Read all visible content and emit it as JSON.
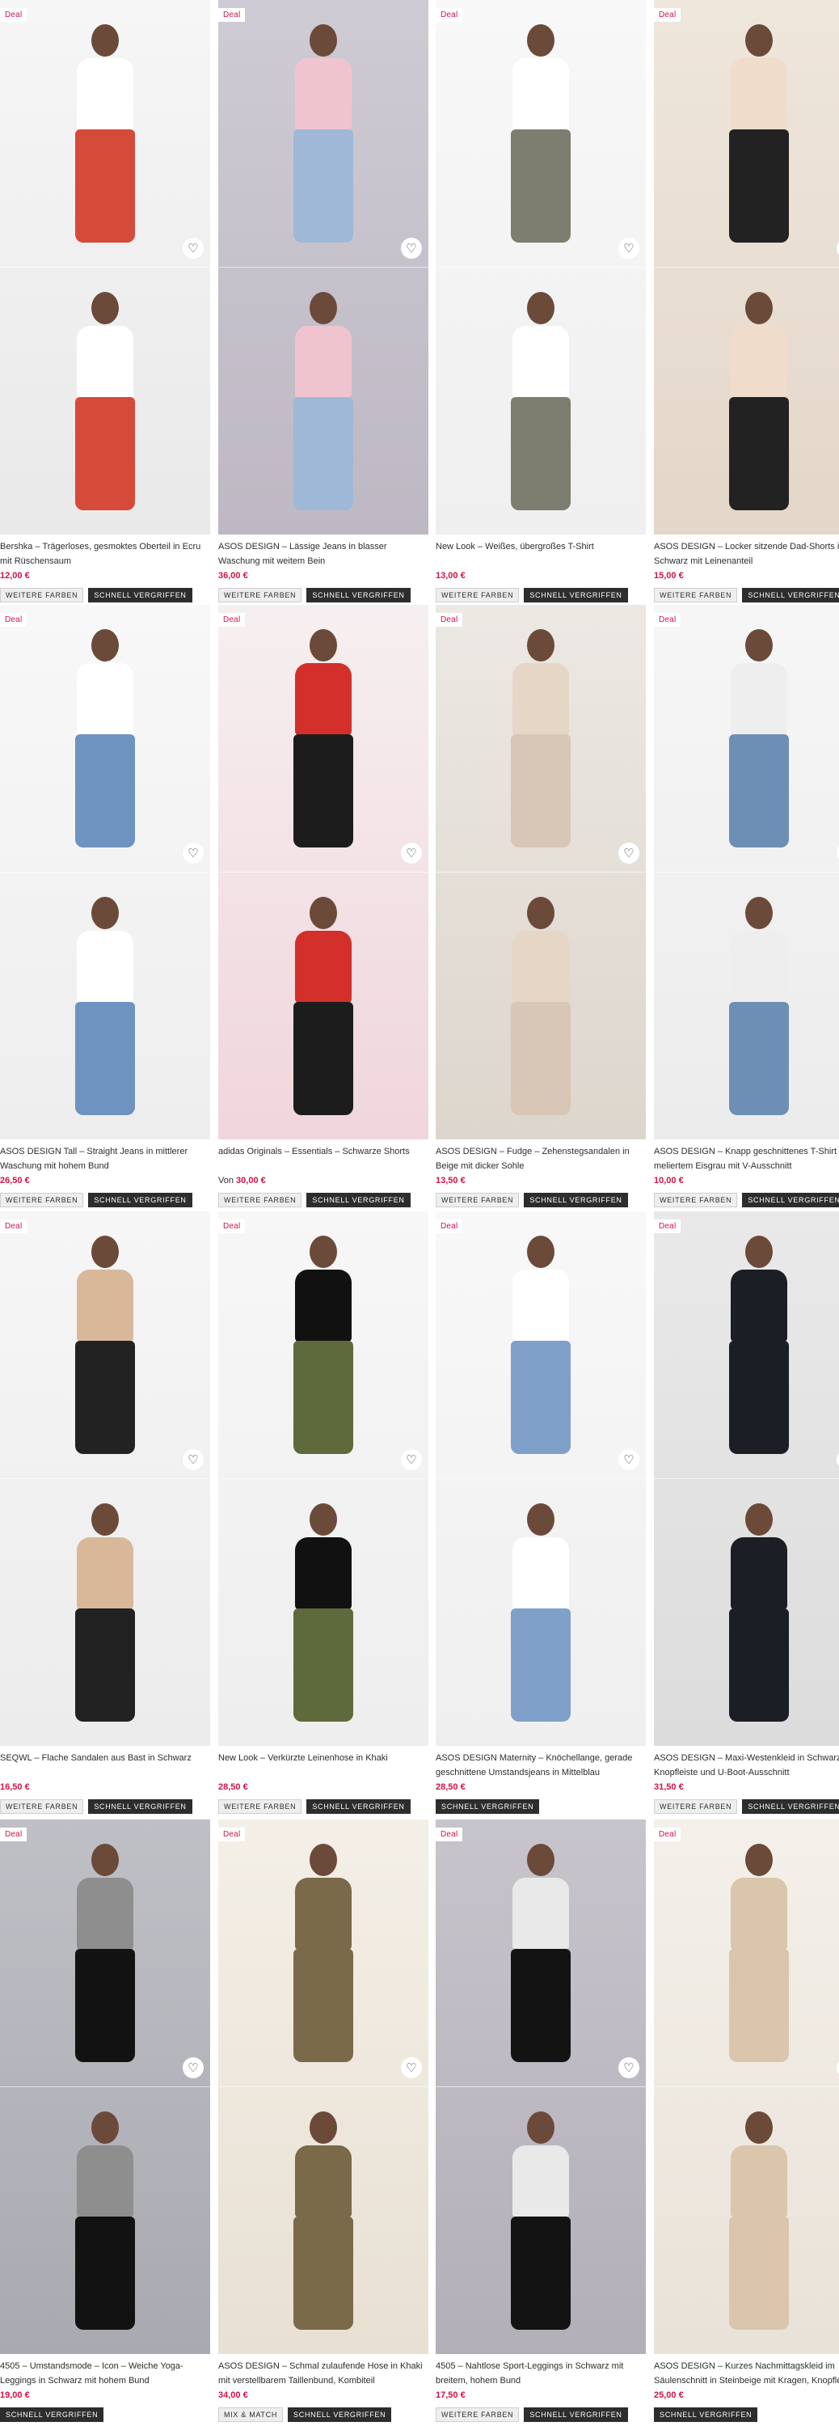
{
  "colors": {
    "deal": "#d01345",
    "price": "#d01345",
    "quick_bg": "#2d2d2d"
  },
  "labels": {
    "deal": "Deal",
    "more_colors": "WEITERE FARBEN",
    "quick_buy": "SCHNELL VERGRIFFEN",
    "mix_match": "MIX & MATCH"
  },
  "products": [
    {
      "deal": true,
      "name": "Bershka – Trägerloses, gesmoktes Oberteil in Ecru mit Rüschensaum",
      "price": "12,00 €",
      "von": "",
      "tags": [
        "more",
        "quick"
      ],
      "bg": [
        "#f6f6f6",
        "#e9e9e9"
      ],
      "top": "#ffffff",
      "bottom": "#d64a3a"
    },
    {
      "deal": true,
      "name": "ASOS DESIGN – Lässige Jeans in blasser Waschung mit weitem Bein",
      "price": "36,00 €",
      "von": "",
      "tags": [
        "more",
        "quick"
      ],
      "bg": [
        "#cfcbd4",
        "#bdb8c3"
      ],
      "top": "#f0c4cf",
      "bottom": "#9fb8d8"
    },
    {
      "deal": true,
      "name": "New Look – Weißes, übergroßes T-Shirt",
      "price": "13,00 €",
      "von": "",
      "tags": [
        "more",
        "quick"
      ],
      "bg": [
        "#f8f8f8",
        "#efefef"
      ],
      "top": "#ffffff",
      "bottom": "#7d7d70"
    },
    {
      "deal": true,
      "name": "ASOS DESIGN – Locker sitzende Dad-Shorts in Schwarz mit Leinenanteil",
      "price": "15,00 €",
      "von": "",
      "tags": [
        "more",
        "quick"
      ],
      "bg": [
        "#efe6dc",
        "#e3d7c9"
      ],
      "top": "#efdccb",
      "bottom": "#222222"
    },
    {
      "deal": true,
      "name": "ASOS DESIGN Tall – Straight Jeans in mittlerer Waschung mit hohem Bund",
      "price": "26,50 €",
      "von": "",
      "tags": [
        "more",
        "quick"
      ],
      "bg": [
        "#f8f8f8",
        "#eeeeee"
      ],
      "top": "#ffffff",
      "bottom": "#6f93c0"
    },
    {
      "deal": true,
      "name": "adidas Originals – Essentials – Schwarze Shorts",
      "price": "30,00 €",
      "von": "Von",
      "tags": [
        "more",
        "quick"
      ],
      "bg": [
        "#f6eff0",
        "#f0d6dc"
      ],
      "top": "#d3302b",
      "bottom": "#1c1c1c"
    },
    {
      "deal": true,
      "name": "ASOS DESIGN – Fudge – Zehenstegsandalen in Beige mit dicker Sohle",
      "price": "13,50 €",
      "von": "",
      "tags": [
        "more",
        "quick"
      ],
      "bg": [
        "#ece8e3",
        "#ddd6cd"
      ],
      "top": "#e6d6c6",
      "bottom": "#d8c7b6"
    },
    {
      "deal": true,
      "name": "ASOS DESIGN – Knapp geschnittenes T-Shirt in meliertem Eisgrau mit V-Ausschnitt",
      "price": "10,00 €",
      "von": "",
      "tags": [
        "more",
        "quick"
      ],
      "bg": [
        "#f6f6f6",
        "#ececec"
      ],
      "top": "#eeeeee",
      "bottom": "#6d8fb5"
    },
    {
      "deal": true,
      "name": "SEQWL – Flache Sandalen aus Bast in Schwarz",
      "price": "16,50 €",
      "von": "",
      "tags": [
        "more",
        "quick"
      ],
      "bg": [
        "#f6f6f6",
        "#ececec"
      ],
      "top": "#d9b89a",
      "bottom": "#222222"
    },
    {
      "deal": true,
      "name": "New Look – Verkürzte Leinenhose in Khaki",
      "price": "28,50 €",
      "von": "",
      "tags": [
        "more",
        "quick"
      ],
      "bg": [
        "#f7f7f7",
        "#eeeeee"
      ],
      "top": "#111111",
      "bottom": "#5e6a3c"
    },
    {
      "deal": true,
      "name": "ASOS DESIGN Maternity – Knöchellange, gerade geschnittene Umstandsjeans in Mittelblau",
      "price": "28,50 €",
      "von": "",
      "tags": [
        "quick"
      ],
      "bg": [
        "#f8f8f8",
        "#efefef"
      ],
      "top": "#ffffff",
      "bottom": "#7fa0c8"
    },
    {
      "deal": true,
      "name": "ASOS DESIGN – Maxi-Westenkleid in Schwarz mit Knopfleiste und U-Boot-Ausschnitt",
      "price": "31,50 €",
      "von": "",
      "tags": [
        "more",
        "quick"
      ],
      "bg": [
        "#e9e9e9",
        "#dcdcdc"
      ],
      "top": "#1b1e24",
      "bottom": "#1b1e24"
    },
    {
      "deal": true,
      "name": "4505 – Umstandsmode – Icon – Weiche Yoga-Leggings in Schwarz mit hohem Bund",
      "price": "19,00 €",
      "von": "",
      "tags": [
        "quick"
      ],
      "bg": [
        "#bfbfc6",
        "#a9a9b1"
      ],
      "top": "#8e8e8e",
      "bottom": "#121212"
    },
    {
      "deal": true,
      "name": "ASOS DESIGN – Schmal zulaufende Hose in Khaki mit verstellbarem Taillenbund, Kombiteil",
      "price": "34,00 €",
      "von": "",
      "tags": [
        "mix",
        "quick"
      ],
      "bg": [
        "#f4efe7",
        "#e8e0d3"
      ],
      "top": "#7a6a4a",
      "bottom": "#7a6a4a"
    },
    {
      "deal": true,
      "name": "4505 – Nahtlose Sport-Leggings in Schwarz mit breitem, hohem Bund",
      "price": "17,50 €",
      "von": "",
      "tags": [
        "more",
        "quick"
      ],
      "bg": [
        "#c7c4cc",
        "#b3afb9"
      ],
      "top": "#e9e9e9",
      "bottom": "#131313"
    },
    {
      "deal": true,
      "name": "ASOS DESIGN – Kurzes Nachmittagskleid im Säulenschnitt in Steinbeige mit Kragen, Knopfleiste und Gürtel",
      "price": "25,00 €",
      "von": "",
      "tags": [
        "quick"
      ],
      "bg": [
        "#f4f0ea",
        "#e9e2d8"
      ],
      "top": "#d9c6ad",
      "bottom": "#d9c6ad"
    }
  ]
}
